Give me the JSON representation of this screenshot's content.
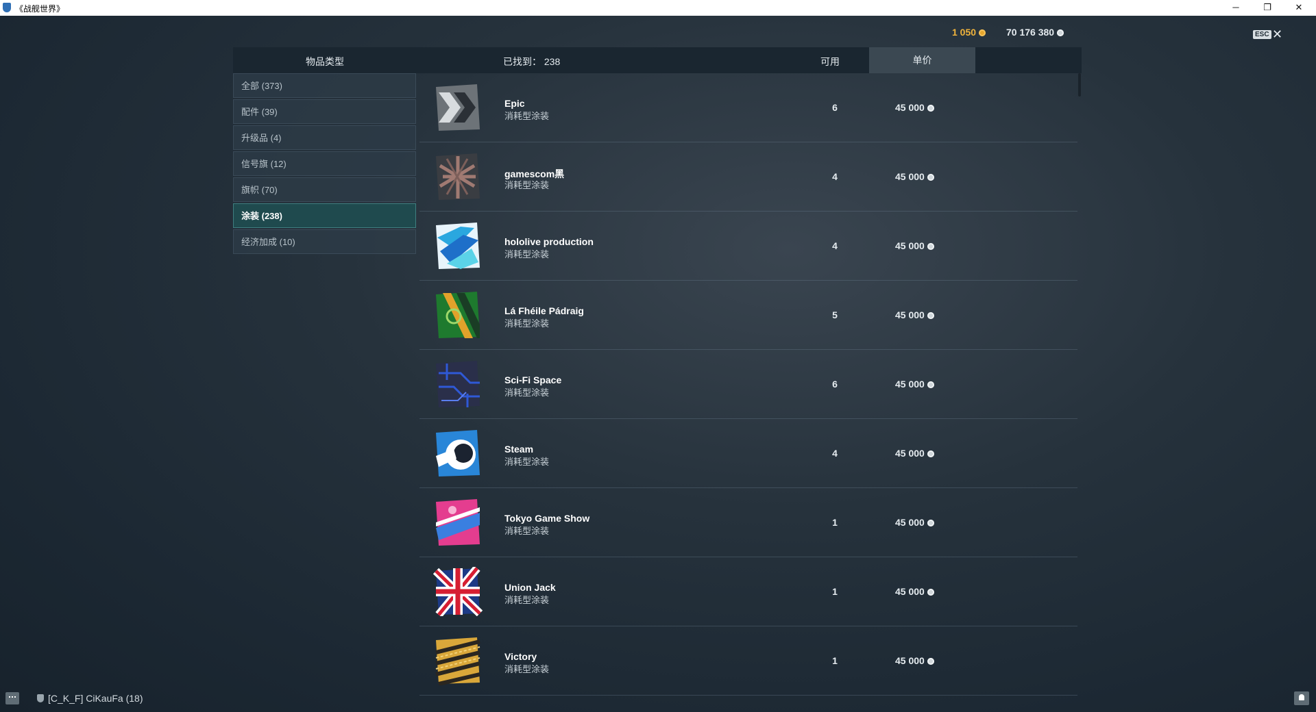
{
  "window": {
    "title": "《战舰世界》",
    "minimize": "─",
    "maximize": "❐",
    "close": "✕"
  },
  "currency": {
    "gold": "1 050",
    "credits": "70 176 380",
    "gold_color": "#f1b43c"
  },
  "esc": {
    "label": "ESC",
    "close": "✕"
  },
  "header": {
    "category_label": "物品类型",
    "found_label": "已找到： 238",
    "available_label": "可用",
    "price_label": "单价"
  },
  "categories": [
    {
      "label": "全部 (373)"
    },
    {
      "label": "配件 (39)"
    },
    {
      "label": "升级品 (4)"
    },
    {
      "label": "信号旗 (12)"
    },
    {
      "label": "旗帜 (70)"
    },
    {
      "label": "涂装 (238)",
      "active": true
    },
    {
      "label": "经济加成 (10)"
    }
  ],
  "items": [
    {
      "name": "Epic",
      "type": "消耗型涂装",
      "qty": "6",
      "price": "45 000",
      "icon": "epic-camo-icon"
    },
    {
      "name": "gamescom黑",
      "type": "消耗型涂装",
      "qty": "4",
      "price": "45 000",
      "icon": "gamescom-camo-icon"
    },
    {
      "name": "hololive production",
      "type": "消耗型涂装",
      "qty": "4",
      "price": "45 000",
      "icon": "hololive-camo-icon"
    },
    {
      "name": "Lá Fhéile Pádraig",
      "type": "消耗型涂装",
      "qty": "5",
      "price": "45 000",
      "icon": "st-patrick-camo-icon"
    },
    {
      "name": "Sci-Fi Space",
      "type": "消耗型涂装",
      "qty": "6",
      "price": "45 000",
      "icon": "scifi-camo-icon"
    },
    {
      "name": "Steam",
      "type": "消耗型涂装",
      "qty": "4",
      "price": "45 000",
      "icon": "steam-camo-icon"
    },
    {
      "name": "Tokyo Game Show",
      "type": "消耗型涂装",
      "qty": "1",
      "price": "45 000",
      "icon": "tgs-camo-icon"
    },
    {
      "name": "Union Jack",
      "type": "消耗型涂装",
      "qty": "1",
      "price": "45 000",
      "icon": "union-jack-camo-icon"
    },
    {
      "name": "Victory",
      "type": "消耗型涂装",
      "qty": "1",
      "price": "45 000",
      "icon": "victory-camo-icon"
    }
  ],
  "footer": {
    "player": "[C_K_F]  CiKauFa (18)"
  }
}
